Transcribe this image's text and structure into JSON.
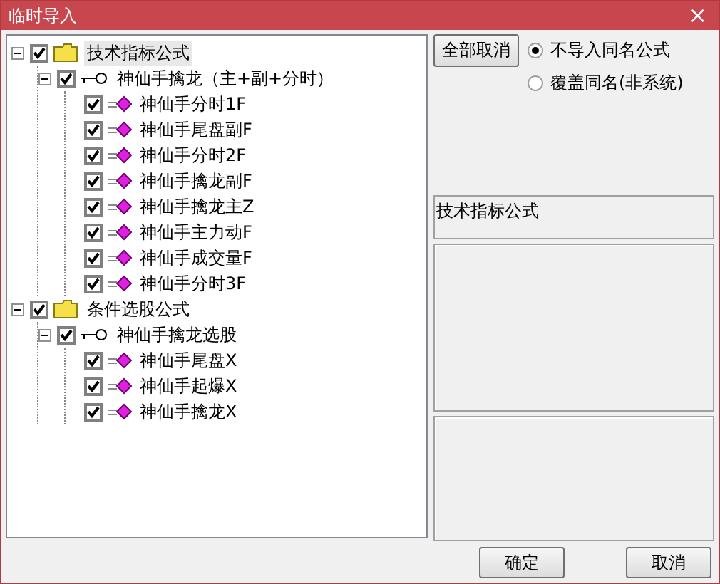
{
  "window": {
    "title": "临时导入",
    "close": "×"
  },
  "tree": [
    {
      "kind": "folder",
      "label": "技术指标公式",
      "checked": true,
      "expanded": true,
      "selected": true,
      "children": [
        {
          "kind": "group",
          "label": "神仙手擒龙（主+副+分时）",
          "checked": true,
          "expanded": true,
          "selected": false,
          "children": [
            {
              "kind": "formula",
              "label": "神仙手分时1F",
              "checked": true,
              "selected": false
            },
            {
              "kind": "formula",
              "label": "神仙手尾盘副F",
              "checked": true,
              "selected": false
            },
            {
              "kind": "formula",
              "label": "神仙手分时2F",
              "checked": true,
              "selected": false
            },
            {
              "kind": "formula",
              "label": "神仙手擒龙副F",
              "checked": true,
              "selected": false
            },
            {
              "kind": "formula",
              "label": "神仙手擒龙主Z",
              "checked": true,
              "selected": false
            },
            {
              "kind": "formula",
              "label": "神仙手主力动F",
              "checked": true,
              "selected": false
            },
            {
              "kind": "formula",
              "label": "神仙手成交量F",
              "checked": true,
              "selected": false
            },
            {
              "kind": "formula",
              "label": "神仙手分时3F",
              "checked": true,
              "selected": false
            }
          ]
        }
      ]
    },
    {
      "kind": "folder",
      "label": "条件选股公式",
      "checked": true,
      "expanded": true,
      "selected": false,
      "children": [
        {
          "kind": "group",
          "label": "神仙手擒龙选股",
          "checked": true,
          "expanded": true,
          "selected": false,
          "children": [
            {
              "kind": "formula",
              "label": "神仙手尾盘X",
              "checked": true,
              "selected": false
            },
            {
              "kind": "formula",
              "label": "神仙手起爆X",
              "checked": true,
              "selected": false
            },
            {
              "kind": "formula",
              "label": "神仙手擒龙X",
              "checked": true,
              "selected": false
            }
          ]
        }
      ]
    }
  ],
  "deselect_all_button": "全部取消",
  "options": [
    {
      "label": "不导入同名公式",
      "selected": true
    },
    {
      "label": "覆盖同名(非系统)",
      "selected": false
    }
  ],
  "category_label": "技术指标公式",
  "buttons": [
    "确定",
    "取消"
  ]
}
